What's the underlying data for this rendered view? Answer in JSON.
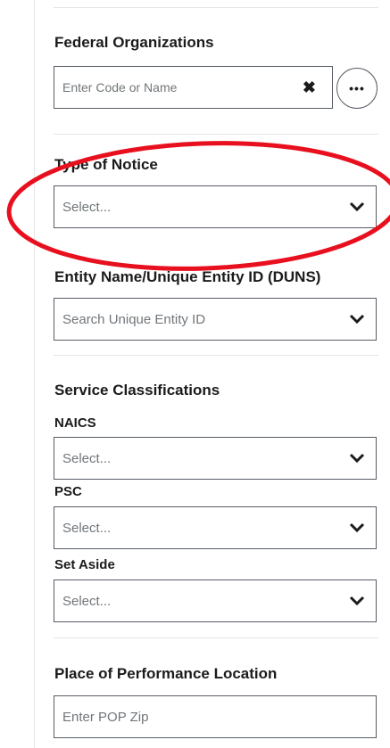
{
  "federal_orgs": {
    "label": "Federal Organizations",
    "input_placeholder": "Enter Code or Name",
    "clear_glyph": "✖",
    "more_glyph": "•••"
  },
  "notice_type": {
    "label": "Type of Notice",
    "placeholder": "Select..."
  },
  "entity": {
    "label": "Entity Name/Unique Entity ID (DUNS)",
    "placeholder": "Search Unique Entity ID"
  },
  "service": {
    "heading": "Service Classifications",
    "naics": {
      "label": "NAICS",
      "placeholder": "Select..."
    },
    "psc": {
      "label": "PSC",
      "placeholder": "Select..."
    },
    "set_aside": {
      "label": "Set Aside",
      "placeholder": "Select..."
    }
  },
  "pop": {
    "label": "Place of Performance Location",
    "placeholder": "Enter POP Zip"
  },
  "colors": {
    "annotation": "#e8101e",
    "border": "#565c65",
    "placeholder": "#71767a"
  }
}
